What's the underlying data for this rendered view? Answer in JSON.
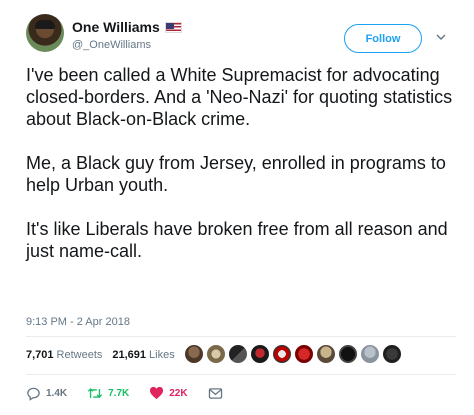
{
  "user": {
    "display_name": "One Williams",
    "handle": "@_OneWilliams",
    "flag_icon": "us-flag-icon"
  },
  "header": {
    "follow_label": "Follow"
  },
  "tweet": {
    "paragraphs": [
      "I've been called a White Supremacist for advocating closed-borders. And a 'Neo-Nazi' for quoting statistics about Black-on-Black crime.",
      "Me, a Black guy from Jersey, enrolled in programs to help Urban youth.",
      "It's like Liberals have broken free from all reason and just name-call."
    ],
    "timestamp": "9:13 PM - 2 Apr 2018"
  },
  "stats": {
    "retweets_count": "7,701",
    "retweets_label": "Retweets",
    "likes_count": "21,691",
    "likes_label": "Likes"
  },
  "actions": {
    "reply_count": "1.4K",
    "retweet_count": "7.7K",
    "like_count": "22K"
  },
  "colors": {
    "accent": "#1da1f2",
    "retweet_green": "#17bf63",
    "like_red": "#e0245e",
    "muted": "#657786"
  }
}
